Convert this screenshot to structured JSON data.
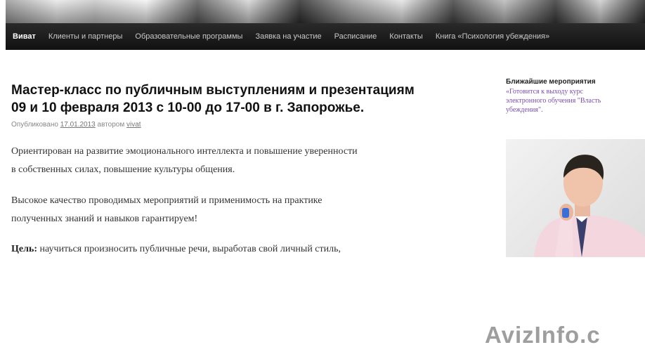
{
  "nav": {
    "items": [
      "Виват",
      "Клиенты и партнеры",
      "Образовательные программы",
      "Заявка на участие",
      "Расписание",
      "Контакты",
      "Книга «Психология убеждения»"
    ]
  },
  "post": {
    "title_line1": "Мастер-класс по публичным выступлениям и презентациям",
    "title_line2": "09 и 10 февраля 2013 с 10-00 до 17-00 в г. Запорожье.",
    "meta_prefix": "Опубликовано",
    "meta_date": "17.01.2013",
    "meta_mid": "автором",
    "meta_author": "vivat",
    "p1_line1": "Ориентирован на развитие эмоционального интеллекта и повышение уверенности",
    "p1_line2": "в собственных силах, повышение культуры общения.",
    "p2_line1": "Высокое качество проводимых мероприятий и применимость на практике",
    "p2_line2": "полученных знаний и навыков гарантируем!",
    "p3_label": "Цель:",
    "p3_text": " научиться произносить публичные речи, выработав свой личный стиль,"
  },
  "sidebar": {
    "title": "Ближайшие мероприятия",
    "link_line1": "«Готовится к выходу курс",
    "link_line2": "электронного обучения \"Власть",
    "link_line3": "убеждения\"."
  },
  "watermark": "AvizInfo.c",
  "colors": {
    "nav_bg": "#111111",
    "link_purple": "#7a4fb0"
  }
}
